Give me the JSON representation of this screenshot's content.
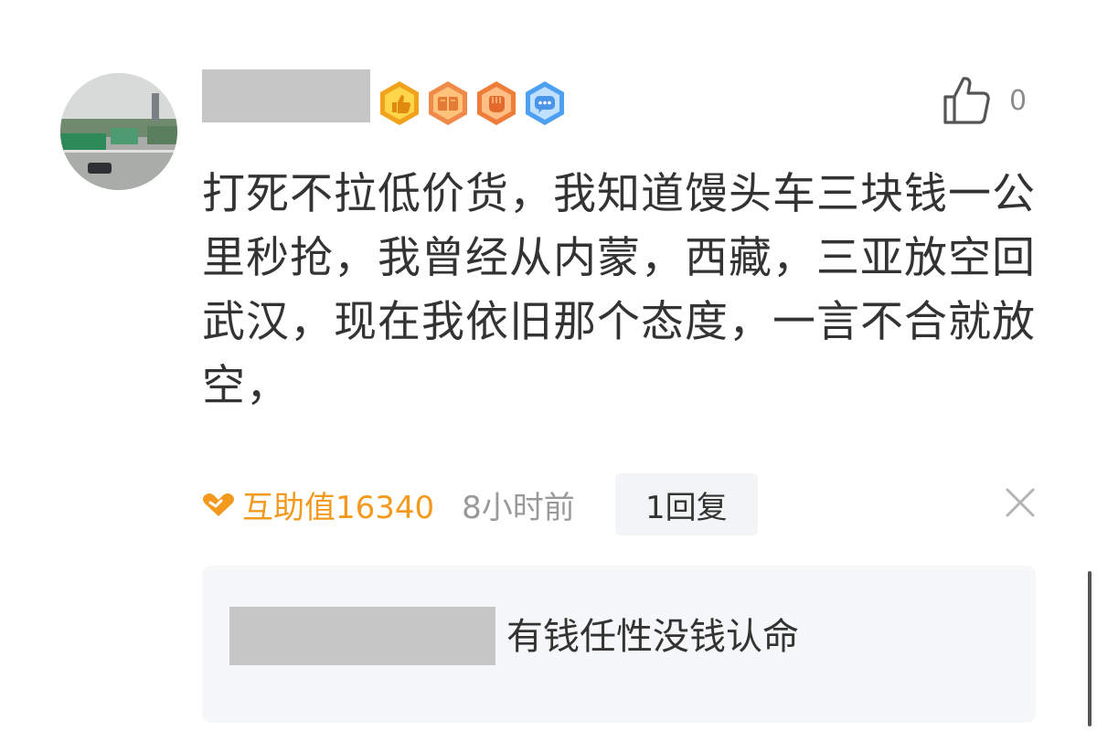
{
  "comment": {
    "avatar_icon": "truck-parking-lot-photo",
    "badges": [
      {
        "icon": "thumb-badge-icon",
        "color": "#f0a21c"
      },
      {
        "icon": "book-badge-icon",
        "color": "#f08a4a"
      },
      {
        "icon": "fist-badge-icon",
        "color": "#f08a4a"
      },
      {
        "icon": "chat-badge-icon",
        "color": "#4da0f0"
      }
    ],
    "like_count": "0",
    "text": "打死不拉低价货，我知道馒头车三块钱一公里秒抢，我曾经从内蒙，西藏，三亚放空回武汉，现在我依旧那个态度，一言不合就放空，",
    "help_value": "互助值16340",
    "timestamp": "8小时前",
    "reply_button": "1回复"
  },
  "reply": {
    "text": "有钱任性没钱认命"
  },
  "colors": {
    "accent_orange": "#f39a1e",
    "text_primary": "#333333",
    "text_secondary": "#999999",
    "reply_bg": "#f6f7f8"
  }
}
